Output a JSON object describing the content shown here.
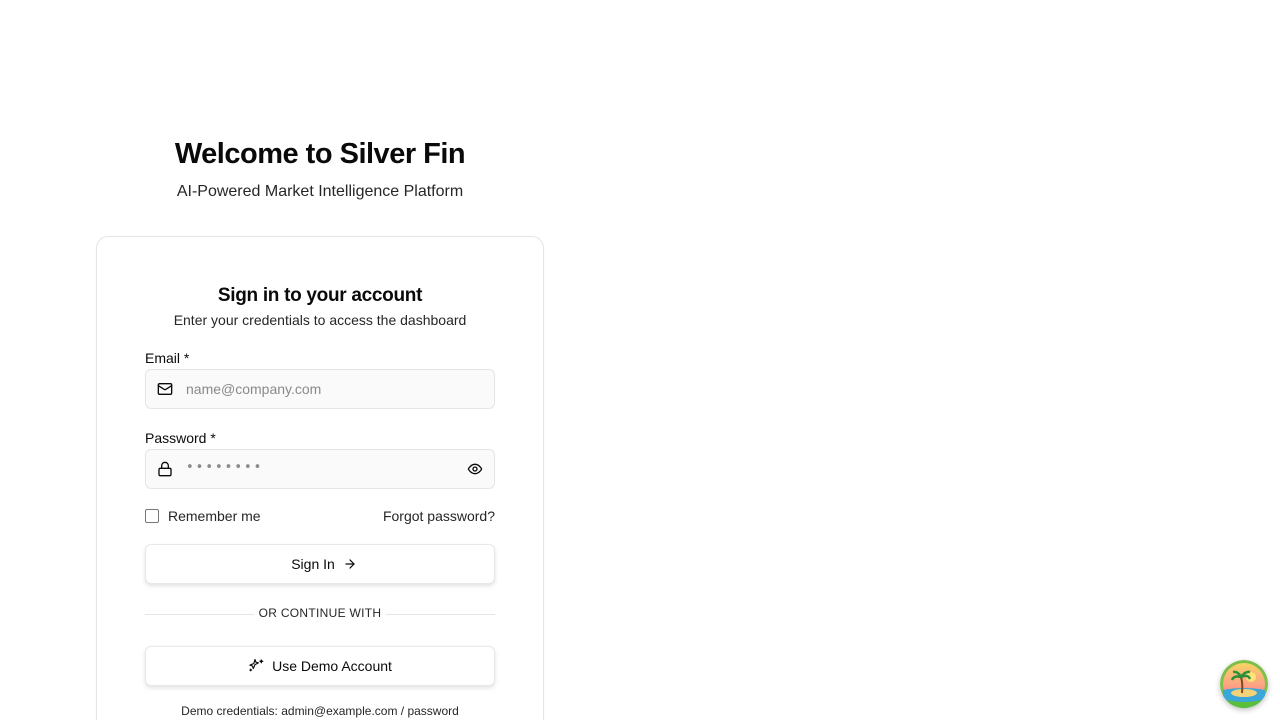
{
  "hero": {
    "title": "Welcome to Silver Fin",
    "subtitle": "AI-Powered Market Intelligence Platform"
  },
  "card": {
    "title": "Sign in to your account",
    "description": "Enter your credentials to access the dashboard"
  },
  "form": {
    "email_label": "Email *",
    "email_placeholder": "name@company.com",
    "email_icon": "mail-icon",
    "password_label": "Password *",
    "password_placeholder": "••••••••",
    "password_icon": "lock-icon",
    "password_toggle_icon": "eye-icon",
    "remember_label": "Remember me",
    "forgot_label": "Forgot password?",
    "signin_label": "Sign In",
    "signin_icon": "arrow-right-icon"
  },
  "divider": {
    "text": "OR CONTINUE WITH"
  },
  "demo": {
    "button_label": "Use Demo Account",
    "button_icon": "sparkles-icon",
    "credentials_text": "Demo credentials: admin@example.com / password"
  },
  "assistant": {
    "icon": "island-avatar-icon"
  },
  "colors": {
    "text": "#0a0a0a",
    "border": "#e5e5e5",
    "field_bg": "#fafafa",
    "placeholder": "#8a8a8a"
  }
}
